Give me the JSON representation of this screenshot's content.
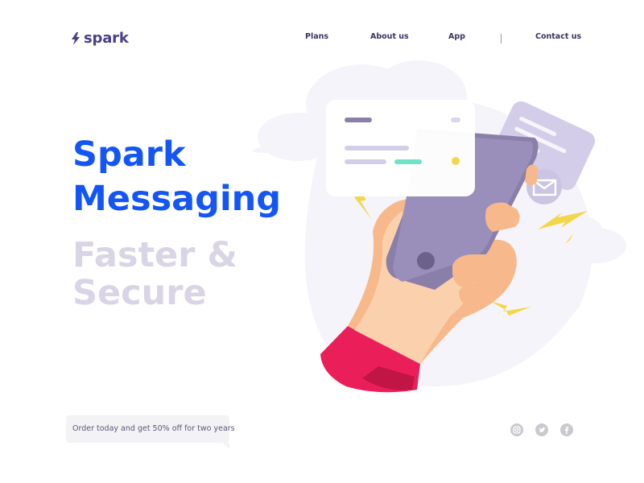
{
  "brand": {
    "name": "spark",
    "icon": "lightning-bolt-icon",
    "color": "#4d3f86"
  },
  "nav": {
    "items": [
      {
        "label": "Plans"
      },
      {
        "label": "About us"
      },
      {
        "label": "App"
      },
      {
        "label": "Contact us"
      }
    ]
  },
  "hero": {
    "title_line1": "Spark",
    "title_line2": "Messaging",
    "subtitle_line1": "Faster &",
    "subtitle_line2": "Secure",
    "title_color": "#1456f5",
    "subtitle_color": "#d9d5e6"
  },
  "promo": {
    "text": "Order today and get 50% off for two years"
  },
  "social": [
    {
      "icon": "instagram-icon"
    },
    {
      "icon": "twitter-icon"
    },
    {
      "icon": "facebook-icon"
    }
  ],
  "illustration": {
    "subject": "hand-holding-phone-illustration",
    "accent": "#f2d74b"
  }
}
